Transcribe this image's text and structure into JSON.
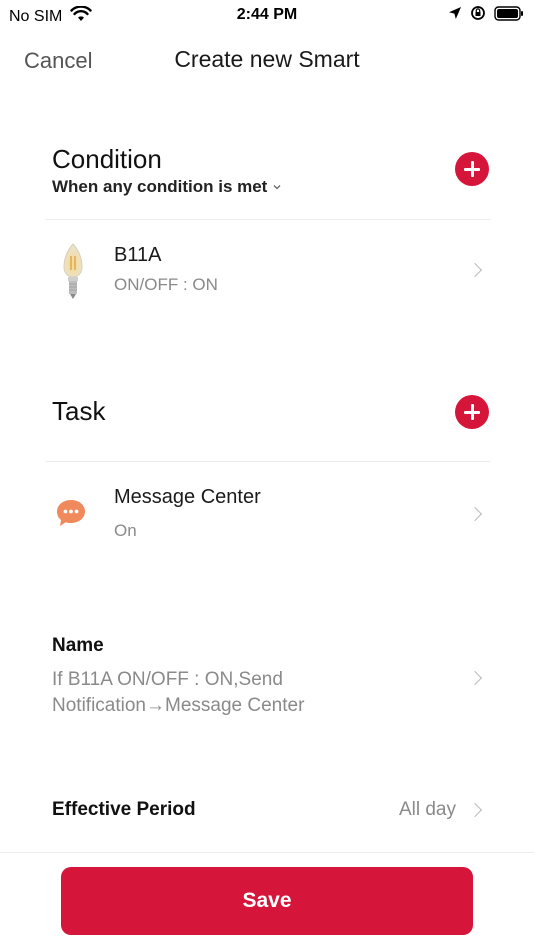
{
  "status_bar": {
    "carrier": "No SIM",
    "time": "2:44 PM",
    "icons": [
      "wifi-icon",
      "location-icon",
      "orientation-lock-icon",
      "battery-icon"
    ]
  },
  "nav": {
    "cancel_label": "Cancel",
    "title": "Create new Smart"
  },
  "condition": {
    "title": "Condition",
    "mode": "When any condition is met",
    "items": [
      {
        "title": "B11A",
        "subtitle": "ON/OFF : ON",
        "icon": "bulb-icon"
      }
    ]
  },
  "task": {
    "title": "Task",
    "items": [
      {
        "title": "Message Center",
        "subtitle": "On",
        "icon": "message-bubble-icon"
      }
    ]
  },
  "name": {
    "label": "Name",
    "value": "If B11A ON/OFF : ON,Send Notification→Message Center"
  },
  "effective_period": {
    "label": "Effective Period",
    "value": "All day"
  },
  "save_label": "Save",
  "colors": {
    "accent": "#d5153a",
    "message_icon": "#f08a5d",
    "secondary_text": "#8a8a8a"
  }
}
